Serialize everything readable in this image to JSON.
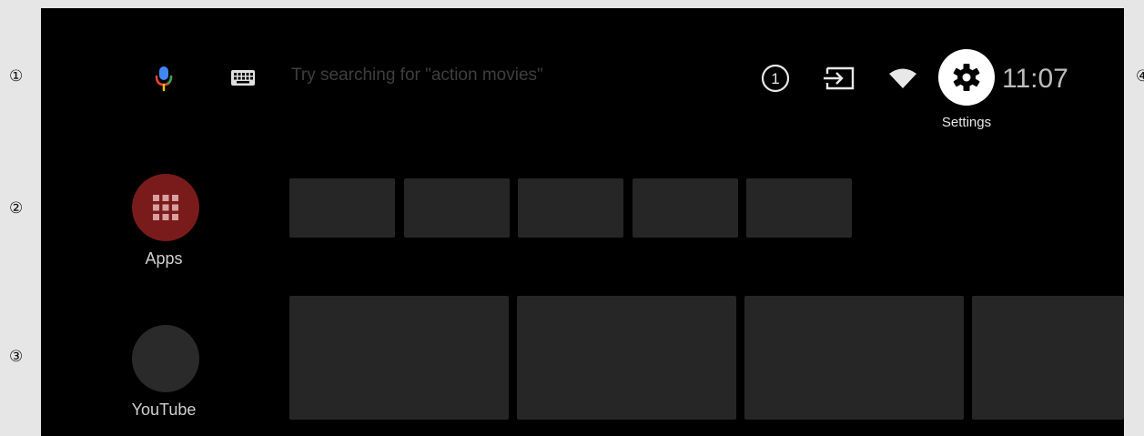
{
  "callouts": [
    "①",
    "②",
    "③",
    "④"
  ],
  "top_bar": {
    "search_placeholder": "Try searching for \"action movies\"",
    "notification_count": "1",
    "settings_label": "Settings",
    "clock": "11:07"
  },
  "rows": [
    {
      "label": "Apps",
      "tile_count": 5
    },
    {
      "label": "YouTube",
      "tile_count": 4
    }
  ],
  "colors": {
    "screen_bg": "#000000",
    "tile": "#262626",
    "apps_circle": "#7a1b1b",
    "mic_blue": "#4285f4",
    "mic_red": "#ea4335",
    "mic_yellow": "#fbbc05",
    "mic_green": "#34a853"
  },
  "icons": {
    "mic": "microphone-icon",
    "keyboard": "keyboard-icon",
    "notification": "notification-icon",
    "inputs": "input-source-icon",
    "wifi": "wifi-icon",
    "settings": "gear-icon",
    "apps": "apps-grid-icon"
  }
}
